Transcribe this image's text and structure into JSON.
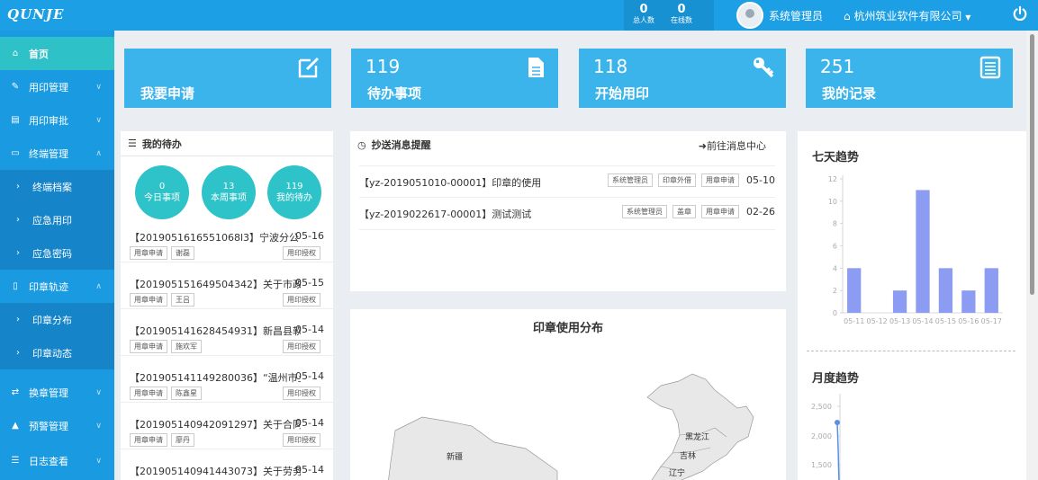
{
  "header": {
    "logo": "QUNJE",
    "stats": [
      {
        "value": "0",
        "label": "总人数"
      },
      {
        "value": "0",
        "label": "在线数"
      }
    ],
    "user": "系统管理员",
    "company": "杭州筑业软件有限公司",
    "colors": {
      "header": "#1c9fe5",
      "sidebar": "#1a9ae0",
      "active": "#2fc1c8",
      "card": "#3bb4ec",
      "bar": "#8c9cf2"
    }
  },
  "sidebar": {
    "items": [
      {
        "label": "首页",
        "icon": "home-icon"
      },
      {
        "label": "用印管理",
        "icon": "edit-icon"
      },
      {
        "label": "用印审批",
        "icon": "document-icon"
      },
      {
        "label": "终端管理",
        "icon": "folder-icon"
      },
      {
        "label": "终端档案",
        "icon": "chevron-right-icon"
      },
      {
        "label": "应急用印",
        "icon": "chevron-right-icon"
      },
      {
        "label": "应急密码",
        "icon": "chevron-right-icon"
      },
      {
        "label": "印章轨迹",
        "icon": "map-icon"
      },
      {
        "label": "印章分布",
        "icon": "chevron-right-icon"
      },
      {
        "label": "印章动态",
        "icon": "chevron-right-icon"
      },
      {
        "label": "换章管理",
        "icon": "exchange-icon"
      },
      {
        "label": "预警管理",
        "icon": "bell-icon"
      },
      {
        "label": "日志查看",
        "icon": "list-icon"
      }
    ]
  },
  "cards": [
    {
      "number": "",
      "label": "我要申请",
      "icon": "edit-icon"
    },
    {
      "number": "119",
      "label": "待办事项",
      "icon": "file-icon"
    },
    {
      "number": "118",
      "label": "开始用印",
      "icon": "key-icon"
    },
    {
      "number": "251",
      "label": "我的记录",
      "icon": "list-box-icon"
    }
  ],
  "todo_panel": {
    "title": "我的待办",
    "circles": [
      {
        "value": "0",
        "label": "今日事项"
      },
      {
        "value": "13",
        "label": "本周事项"
      },
      {
        "value": "119",
        "label": "我的待办"
      }
    ],
    "items": [
      {
        "title": "【2019051616551068l3】宁波分公",
        "date": "05-16",
        "tags": [
          "用章申请",
          "谢磊"
        ],
        "action": "用印授权"
      },
      {
        "title": "【2019051516495043​42】关于市政",
        "date": "05-15",
        "tags": [
          "用章申请",
          "王吕"
        ],
        "action": "用印授权"
      },
      {
        "title": "【201905141628454931】新昌县软",
        "date": "05-14",
        "tags": [
          "用章申请",
          "施欢军"
        ],
        "action": "用印授权"
      },
      {
        "title": "【201905141149280036】“温州市土",
        "date": "05-14",
        "tags": [
          "用章申请",
          "陈鑫星"
        ],
        "action": "用印授权"
      },
      {
        "title": "【201905140942091297】关于合同",
        "date": "05-14",
        "tags": [
          "用章申请",
          "廖丹"
        ],
        "action": "用印授权"
      },
      {
        "title": "【201905140941443073】关于劳务",
        "date": "05-14",
        "tags": [],
        "action": ""
      }
    ]
  },
  "msg_panel": {
    "title": "抄送消息提醒",
    "link": "前往消息中心",
    "items": [
      {
        "title": "【yz-2019051010-00001】印章的使用",
        "tags": [
          "系统管理员",
          "印章外借",
          "用章申请"
        ],
        "date": "05-10"
      },
      {
        "title": "【yz-2019022617-00001】测试测试",
        "tags": [
          "系统管理员",
          "盖章",
          "用章申请"
        ],
        "date": "02-26"
      }
    ]
  },
  "map_panel": {
    "title": "印章使用分布",
    "labels": [
      "新疆",
      "黑龙江",
      "吉林",
      "辽宁"
    ]
  },
  "trend_panel": {
    "title": "七天趋势",
    "month_title": "月度趋势",
    "month_ticks": [
      "2,500",
      "2,000",
      "1,500"
    ]
  },
  "chart_data": {
    "type": "bar",
    "categories": [
      "05-11",
      "05-12",
      "05-13",
      "05-14",
      "05-15",
      "05-16",
      "05-17"
    ],
    "values": [
      4,
      0,
      2,
      11,
      4,
      2,
      4
    ],
    "ylim": [
      0,
      12
    ],
    "yticks": [
      0,
      2,
      4,
      6,
      8,
      10,
      12
    ]
  }
}
